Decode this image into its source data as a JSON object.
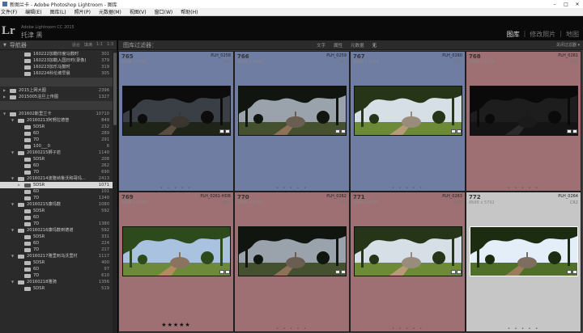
{
  "window": {
    "title": "新图兰卡 - Adobe Photoshop Lightroom - 图库"
  },
  "menu": [
    "文件(F)",
    "编辑(E)",
    "图库(L)",
    "照片(P)",
    "元数据(M)",
    "视图(V)",
    "窗口(W)",
    "帮助(H)"
  ],
  "identity": {
    "logo": "Lr",
    "version": "Adobe Lightroom CC 2015",
    "name": "托津 黑"
  },
  "modules": [
    {
      "label": "图库",
      "active": true
    },
    {
      "label": "修改照片",
      "active": false
    },
    {
      "label": "地图",
      "active": false
    }
  ],
  "navigator": {
    "title": "导航器",
    "opts": [
      "适合",
      "填满",
      "1:1",
      "1:3"
    ]
  },
  "folders": [
    {
      "label": "160222加勒印度马鼓时",
      "count": "301",
      "depth": 3,
      "arrow": "",
      "selected": false
    },
    {
      "label": "160223加勒入园日时(录像)",
      "count": "379",
      "depth": 3,
      "arrow": "",
      "selected": false
    },
    {
      "label": "160223加乐马鼓时",
      "count": "319",
      "depth": 3,
      "arrow": "",
      "selected": false
    },
    {
      "label": "160224科伦坡早晨",
      "count": "305",
      "depth": 3,
      "arrow": "",
      "selected": false
    },
    {
      "label": "",
      "count": "",
      "depth": 0,
      "arrow": "",
      "selected": false,
      "volume": true
    },
    {
      "label": "2015上网大图",
      "count": "2396",
      "depth": 1,
      "arrow": "▶",
      "selected": false
    },
    {
      "label": "2015005泊旦上传图",
      "count": "1327",
      "depth": 1,
      "arrow": "▶",
      "selected": false
    },
    {
      "label": "",
      "count": "",
      "depth": 0,
      "arrow": "",
      "selected": false,
      "volume": true
    },
    {
      "label": "201602斯里兰卡",
      "count": "10710",
      "depth": 1,
      "arrow": "▼",
      "selected": false
    },
    {
      "label": "20160213阿努拉德普",
      "count": "849",
      "depth": 2,
      "arrow": "▼",
      "selected": false
    },
    {
      "label": "5DSR",
      "count": "232",
      "depth": 3,
      "arrow": "",
      "selected": false
    },
    {
      "label": "6D",
      "count": "289",
      "depth": 3,
      "arrow": "",
      "selected": false
    },
    {
      "label": "7D",
      "count": "291",
      "depth": 3,
      "arrow": "",
      "selected": false
    },
    {
      "label": "100___0",
      "count": "6",
      "depth": 3,
      "arrow": "",
      "selected": false
    },
    {
      "label": "20160215狮子岩",
      "count": "1140",
      "depth": 2,
      "arrow": "▼",
      "selected": false
    },
    {
      "label": "5DSR",
      "count": "208",
      "depth": 3,
      "arrow": "",
      "selected": false
    },
    {
      "label": "6D",
      "count": "262",
      "depth": 3,
      "arrow": "",
      "selected": false
    },
    {
      "label": "7D",
      "count": "690",
      "depth": 3,
      "arrow": "",
      "selected": false
    },
    {
      "label": "20160214波隆纳鲁沃和哥玛...",
      "count": "2413",
      "depth": 2,
      "arrow": "▼",
      "selected": false
    },
    {
      "label": "5DSR",
      "count": "1071",
      "depth": 3,
      "arrow": "▶",
      "selected": true
    },
    {
      "label": "6D",
      "count": "101",
      "depth": 3,
      "arrow": "",
      "selected": false
    },
    {
      "label": "7D",
      "count": "1240",
      "depth": 3,
      "arrow": "",
      "selected": false
    },
    {
      "label": "20160215康玛鼓",
      "count": "1080",
      "depth": 2,
      "arrow": "▼",
      "selected": false
    },
    {
      "label": "5DSR",
      "count": "592",
      "depth": 3,
      "arrow": "",
      "selected": false
    },
    {
      "label": "6D",
      "count": "",
      "depth": 3,
      "arrow": "",
      "selected": false
    },
    {
      "label": "7D",
      "count": "1380",
      "depth": 3,
      "arrow": "",
      "selected": false
    },
    {
      "label": "20160216康玛鼓到德道",
      "count": "592",
      "depth": 2,
      "arrow": "▼",
      "selected": false
    },
    {
      "label": "5DSR",
      "count": "331",
      "depth": 3,
      "arrow": "",
      "selected": false
    },
    {
      "label": "6D",
      "count": "224",
      "depth": 3,
      "arrow": "",
      "selected": false
    },
    {
      "label": "7D",
      "count": "217",
      "depth": 3,
      "arrow": "",
      "selected": false
    },
    {
      "label": "20160217雅里到乌沃里村",
      "count": "1117",
      "depth": 2,
      "arrow": "▼",
      "selected": false
    },
    {
      "label": "5DSR",
      "count": "400",
      "depth": 3,
      "arrow": "",
      "selected": false
    },
    {
      "label": "6D",
      "count": "97",
      "depth": 3,
      "arrow": "",
      "selected": false
    },
    {
      "label": "7D",
      "count": "610",
      "depth": 3,
      "arrow": "",
      "selected": false
    },
    {
      "label": "20160218雅骑",
      "count": "1356",
      "depth": 2,
      "arrow": "▼",
      "selected": false
    },
    {
      "label": "5DSR",
      "count": "519",
      "depth": 3,
      "arrow": "",
      "selected": false
    }
  ],
  "filterbar": {
    "title": "图库过滤器：",
    "options": [
      {
        "label": "文字",
        "on": false
      },
      {
        "label": "属性",
        "on": false
      },
      {
        "label": "元数据",
        "on": false
      },
      {
        "label": "无",
        "on": true
      }
    ],
    "right": "关闭过滤器 ▾"
  },
  "colors": {
    "blue_label": "#6f7da3",
    "red_label": "#9e7073",
    "selected_cell": "#c6c6c6"
  },
  "cells": [
    {
      "index": "765",
      "dims": "8688 x 5792",
      "name": "PLH_0258",
      "ext": "CR2",
      "label": "blue",
      "tone": "dark",
      "stars": ""
    },
    {
      "index": "766",
      "dims": "8688 x 5792",
      "name": "PLH_0259",
      "ext": "CR2",
      "label": "blue",
      "tone": "mid",
      "stars": ""
    },
    {
      "index": "767",
      "dims": "8688 x 5792",
      "name": "PLH_0260",
      "ext": "CR2",
      "label": "blue",
      "tone": "bright",
      "stars": ""
    },
    {
      "index": "768",
      "dims": "8688 x 5792",
      "name": "PLH_0261",
      "ext": "CR2",
      "label": "red",
      "tone": "verydark",
      "stars": ""
    },
    {
      "index": "769",
      "dims": "8688 x 5792",
      "name": "PLH_0261-HDR",
      "ext": "DNG",
      "label": "red",
      "tone": "hdr",
      "stars": "★★★★★"
    },
    {
      "index": "770",
      "dims": "8688 x 5792",
      "name": "PLH_0262",
      "ext": "CR2",
      "label": "red",
      "tone": "mid",
      "stars": ""
    },
    {
      "index": "771",
      "dims": "8688 x 5792",
      "name": "PLH_0263",
      "ext": "CR2",
      "label": "red",
      "tone": "bright",
      "stars": ""
    },
    {
      "index": "772",
      "dims": "8688 x 5792",
      "name": "PLH_0264",
      "ext": "CR2",
      "label": "none",
      "tone": "sky",
      "stars": ""
    }
  ]
}
